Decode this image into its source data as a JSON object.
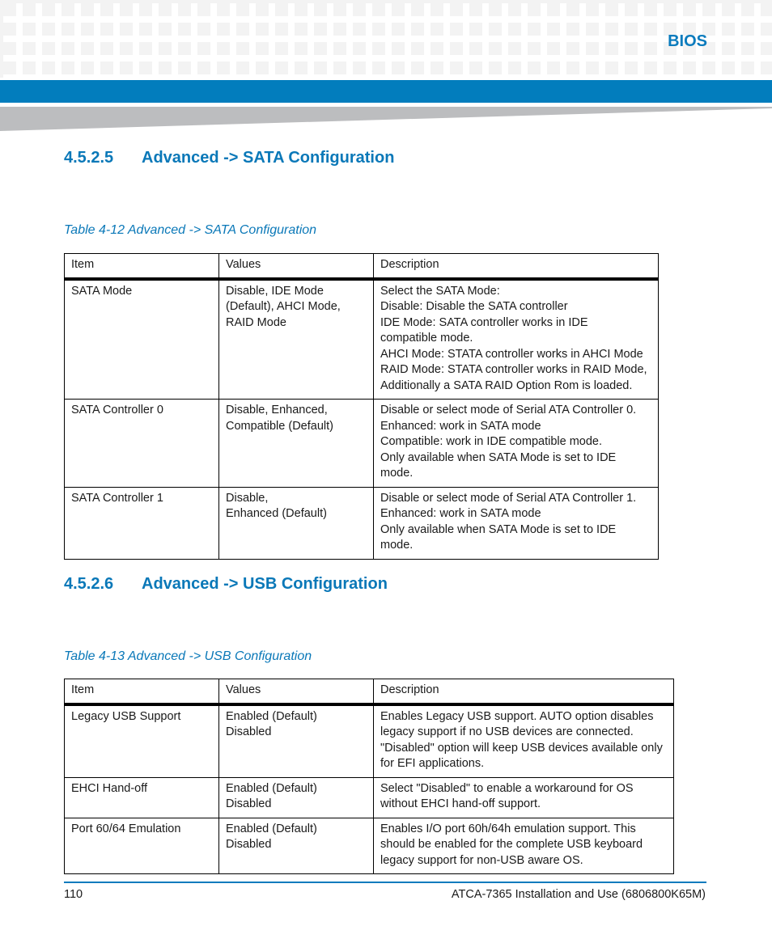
{
  "header": {
    "chapter": "BIOS",
    "colors": {
      "accent": "#027dbd",
      "heading": "#0a78b8",
      "pattern": "#f3f3f3",
      "wedge": "#bcbdbf"
    }
  },
  "sections": [
    {
      "number": "4.5.2.5",
      "title": "Advanced -> SATA Configuration",
      "table": {
        "caption": "Table 4-12 Advanced -> SATA Configuration",
        "columns": [
          "Item",
          "Values",
          "Description"
        ],
        "rows": [
          {
            "item": "SATA Mode",
            "values": [
              "Disable, IDE Mode",
              "(Default), AHCI Mode,",
              "RAID Mode"
            ],
            "description": [
              "Select the SATA Mode:",
              "Disable: Disable the SATA controller",
              "IDE Mode: SATA controller works in IDE",
              "compatible mode.",
              "AHCI Mode: STATA controller works in AHCI Mode",
              "RAID Mode: STATA controller works in RAID Mode,",
              "Additionally a SATA RAID Option Rom is loaded."
            ]
          },
          {
            "item": "SATA Controller 0",
            "values": [
              "Disable, Enhanced,",
              "Compatible (Default)"
            ],
            "description": [
              "Disable or select mode of Serial ATA Controller 0.",
              "Enhanced: work in SATA mode",
              "Compatible: work in IDE compatible mode.",
              "Only available when SATA Mode is set to IDE",
              "mode."
            ]
          },
          {
            "item": "SATA Controller 1",
            "values": [
              "Disable,",
              "Enhanced (Default)"
            ],
            "description": [
              "Disable or select mode of Serial ATA Controller 1.",
              "Enhanced: work in SATA mode",
              "Only available when SATA Mode is set to IDE",
              "mode."
            ]
          }
        ]
      }
    },
    {
      "number": "4.5.2.6",
      "title": "Advanced -> USB Configuration",
      "table": {
        "caption": "Table 4-13 Advanced -> USB Configuration",
        "columns": [
          "Item",
          "Values",
          "Description"
        ],
        "rows": [
          {
            "item": "Legacy USB Support",
            "values": [
              "Enabled (Default)",
              "Disabled"
            ],
            "description": [
              "Enables Legacy USB support. AUTO option disables",
              "legacy support if no USB devices are connected.",
              "\"Disabled\" option will keep USB devices available only",
              "for EFI applications."
            ]
          },
          {
            "item": "EHCI Hand-off",
            "values": [
              "Enabled (Default)",
              "Disabled"
            ],
            "description": [
              "Select \"Disabled\" to enable a workaround for OS",
              "without EHCI hand-off support."
            ]
          },
          {
            "item": "Port 60/64 Emulation",
            "values": [
              "Enabled (Default)",
              "Disabled"
            ],
            "description": [
              "Enables I/O port 60h/64h emulation support. This",
              "should be enabled for the complete USB keyboard",
              "legacy support for non-USB aware OS."
            ]
          }
        ]
      }
    }
  ],
  "footer": {
    "page_number": "110",
    "document_title": "ATCA-7365 Installation and Use (6806800K65M)"
  }
}
